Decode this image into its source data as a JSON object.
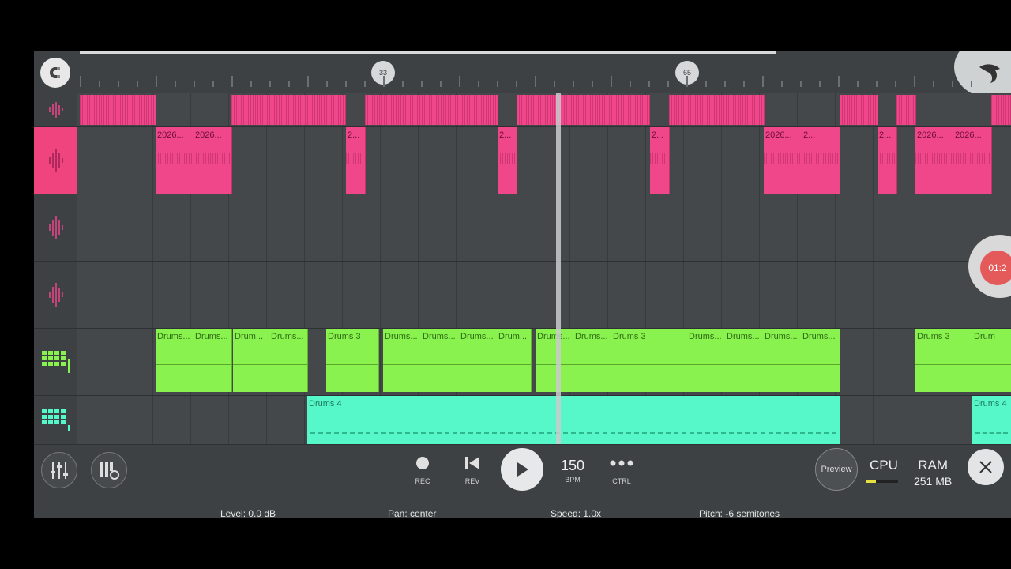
{
  "ruler": {
    "markers": [
      "33",
      "65"
    ]
  },
  "tracks": [
    {
      "type": "audio",
      "active": false,
      "clips": [
        {
          "label": ""
        },
        {
          "label": ""
        },
        {
          "label": ""
        },
        {
          "label": ""
        },
        {
          "label": ""
        },
        {
          "label": ""
        },
        {
          "label": ""
        },
        {
          "label": ""
        }
      ]
    },
    {
      "type": "audio",
      "active": true,
      "clips": [
        {
          "label": "2026..."
        },
        {
          "label": "2026..."
        },
        {
          "label": "2..."
        },
        {
          "label": "2..."
        },
        {
          "label": "2..."
        },
        {
          "label": "2026..."
        },
        {
          "label": "2..."
        },
        {
          "label": "2..."
        },
        {
          "label": "2026..."
        },
        {
          "label": "2026..."
        }
      ]
    },
    {
      "type": "audio",
      "active": false,
      "clips": []
    },
    {
      "type": "audio",
      "active": false,
      "clips": []
    },
    {
      "type": "pattern",
      "active": false,
      "clips": [
        {
          "label": "Drums..."
        },
        {
          "label": "Drums..."
        },
        {
          "label": "Drum..."
        },
        {
          "label": "Drums..."
        },
        {
          "label": "Drums 3"
        },
        {
          "label": "Drums..."
        },
        {
          "label": "Drums..."
        },
        {
          "label": "Drums..."
        },
        {
          "label": "Drum..."
        },
        {
          "label": "Drums..."
        },
        {
          "label": "Drums..."
        },
        {
          "label": "Drums 3"
        },
        {
          "label": "Drums..."
        },
        {
          "label": "Drums..."
        },
        {
          "label": "Drums..."
        },
        {
          "label": "Drums..."
        },
        {
          "label": "Drums 3"
        },
        {
          "label": "Drum"
        }
      ]
    },
    {
      "type": "pattern",
      "active": false,
      "clips": [
        {
          "label": "Drums 4"
        },
        {
          "label": "Drums 4"
        }
      ]
    }
  ],
  "time_badge": "01:2",
  "toolbar": {
    "rec_label": "REC",
    "rev_label": "REV",
    "bpm_value": "150",
    "bpm_label": "BPM",
    "ctrl_label": "CTRL",
    "preview_label": "Preview",
    "cpu_label": "CPU",
    "cpu_fraction": 0.3,
    "ram_label": "RAM",
    "ram_value": "251 MB"
  },
  "status": {
    "level": "Level: 0.0 dB",
    "pan": "Pan: center",
    "speed": "Speed: 1.0x",
    "pitch": "Pitch: -6 semitones"
  },
  "colors": {
    "audio_clip": "#f0468a",
    "pattern_clip": "#8af24f",
    "pattern_clip_alt": "#56f7c8",
    "background": "#3d4143"
  }
}
